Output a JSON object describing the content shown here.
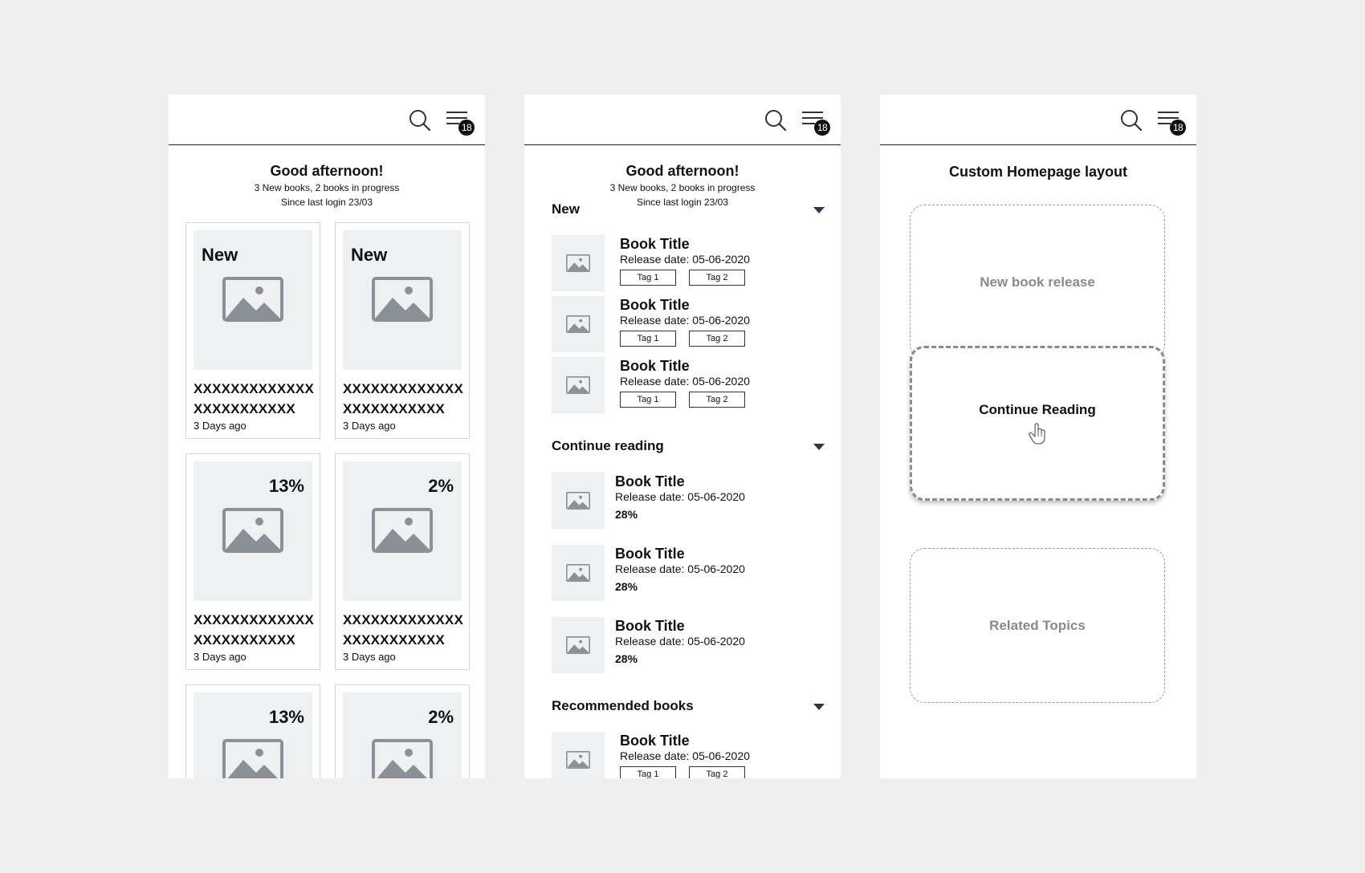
{
  "header": {
    "badge_count": "18"
  },
  "home": {
    "greeting": "Good afternoon!",
    "summary": "3 New books, 2 books in progress",
    "since": "Since last login 23/03"
  },
  "grid_cards": [
    {
      "corner": "New",
      "corner_side": "left",
      "title": "XXXXXXXXXXXXXXXXXXXXXXXX",
      "date": "3 Days ago"
    },
    {
      "corner": "New",
      "corner_side": "left",
      "title": "XXXXXXXXXXXXXXXXXXXXXXXX",
      "date": "3 Days ago"
    },
    {
      "corner": "13%",
      "corner_side": "right",
      "title": "XXXXXXXXXXXXXXXXXXXXXXXX",
      "date": "3 Days ago"
    },
    {
      "corner": "2%",
      "corner_side": "right",
      "title": "XXXXXXXXXXXXXXXXXXXXXXXX",
      "date": "3 Days ago"
    },
    {
      "corner": "13%",
      "corner_side": "right",
      "title": "",
      "date": ""
    },
    {
      "corner": "2%",
      "corner_side": "right",
      "title": "",
      "date": ""
    }
  ],
  "sections": {
    "new": {
      "label": "New",
      "books": [
        {
          "title": "Book Title",
          "release": "Release date: 05-06-2020",
          "tags": [
            "Tag 1",
            "Tag 2"
          ]
        },
        {
          "title": "Book Title",
          "release": "Release date: 05-06-2020",
          "tags": [
            "Tag 1",
            "Tag 2"
          ]
        },
        {
          "title": "Book Title",
          "release": "Release date: 05-06-2020",
          "tags": [
            "Tag 1",
            "Tag 2"
          ]
        }
      ]
    },
    "continue": {
      "label": "Continue reading",
      "books": [
        {
          "title": "Book Title",
          "release": "Release date: 05-06-2020",
          "progress": "28%"
        },
        {
          "title": "Book Title",
          "release": "Release date: 05-06-2020",
          "progress": "28%"
        },
        {
          "title": "Book Title",
          "release": "Release date: 05-06-2020",
          "progress": "28%"
        }
      ]
    },
    "recommended": {
      "label": "Recommended books",
      "books": [
        {
          "title": "Book Title",
          "release": "Release date: 05-06-2020",
          "tags": [
            "Tag 1",
            "Tag 2"
          ]
        }
      ]
    }
  },
  "custom_layout": {
    "title": "Custom Homepage layout",
    "slots": [
      "New book release",
      "Continue Reading",
      "Related Topics"
    ]
  },
  "icons": [
    "search-icon",
    "menu-icon",
    "image-placeholder-icon",
    "caret-down-icon",
    "hand-pointer-icon"
  ]
}
